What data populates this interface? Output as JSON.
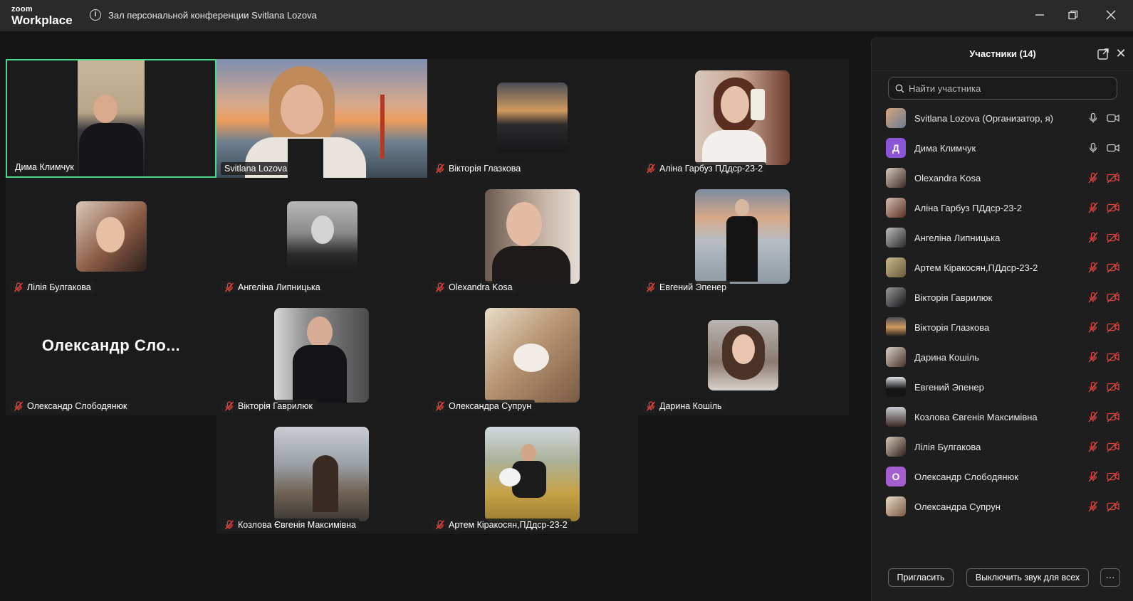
{
  "app": {
    "logo_line1": "zoom",
    "logo_line2": "Workplace",
    "meeting_title": "Зал персональной конференции Svitlana Lozova"
  },
  "colors": {
    "active_border": "#4dd98a",
    "mute_red": "#e0443c",
    "titlebar": "#2a2a2a",
    "panel_bg": "#1e1e1e"
  },
  "tiles": [
    {
      "name": "Дима Климчук",
      "muted": false,
      "active": true
    },
    {
      "name": "Svitlana Lozova",
      "muted": false
    },
    {
      "name": "Вікторія Глазкова",
      "muted": true
    },
    {
      "name": "Аліна Гарбуз ПДдср-23-2",
      "muted": true
    },
    {
      "name": "Лілія Булгакова",
      "muted": true
    },
    {
      "name": "Ангеліна Липницька",
      "muted": true
    },
    {
      "name": "Olexandra Kosa",
      "muted": true
    },
    {
      "name": "Евгений Эпенер",
      "muted": true
    },
    {
      "name": "Олександр Слободянюк",
      "muted": true,
      "big_label": "Олександр  Сло..."
    },
    {
      "name": "Вікторія Гаврилюк",
      "muted": true
    },
    {
      "name": "Олександра Супрун",
      "muted": true
    },
    {
      "name": "Дарина Кошіль",
      "muted": true
    },
    {
      "name": "Козлова Євгенія Максимівна",
      "muted": true
    },
    {
      "name": "Артем Кіракосян,ПДдср-23-2",
      "muted": true
    }
  ],
  "panel": {
    "title": "Участники (14)",
    "search_placeholder": "Найти участника",
    "participants": [
      {
        "name": "Svitlana Lozova (Организатор, я)",
        "avatar": "photo",
        "muted": false
      },
      {
        "name": "Дима Климчук",
        "avatar": "Д",
        "avatar_color": "#8b55d8",
        "muted": false
      },
      {
        "name": "Olexandra Kosa",
        "avatar": "photo",
        "muted": true
      },
      {
        "name": "Аліна Гарбуз ПДдср-23-2",
        "avatar": "photo",
        "muted": true
      },
      {
        "name": "Ангеліна Липницька",
        "avatar": "photo",
        "muted": true
      },
      {
        "name": "Артем Кіракосян,ПДдср-23-2",
        "avatar": "photo",
        "muted": true
      },
      {
        "name": "Вікторія Гаврилюк",
        "avatar": "photo",
        "muted": true
      },
      {
        "name": "Вікторія Глазкова",
        "avatar": "photo",
        "muted": true
      },
      {
        "name": "Дарина Кошіль",
        "avatar": "photo",
        "muted": true
      },
      {
        "name": "Евгений Эпенер",
        "avatar": "photo",
        "muted": true
      },
      {
        "name": "Козлова Євгенія Максимівна",
        "avatar": "photo",
        "muted": true
      },
      {
        "name": "Лілія Булгакова",
        "avatar": "photo",
        "muted": true
      },
      {
        "name": "Олександр Слободянюк",
        "avatar": "О",
        "avatar_color": "#a45ed0",
        "muted": true
      },
      {
        "name": "Олександра Супрун",
        "avatar": "photo",
        "muted": true
      }
    ],
    "invite_label": "Пригласить",
    "mute_all_label": "Выключить звук для всех",
    "more_label": "···"
  }
}
